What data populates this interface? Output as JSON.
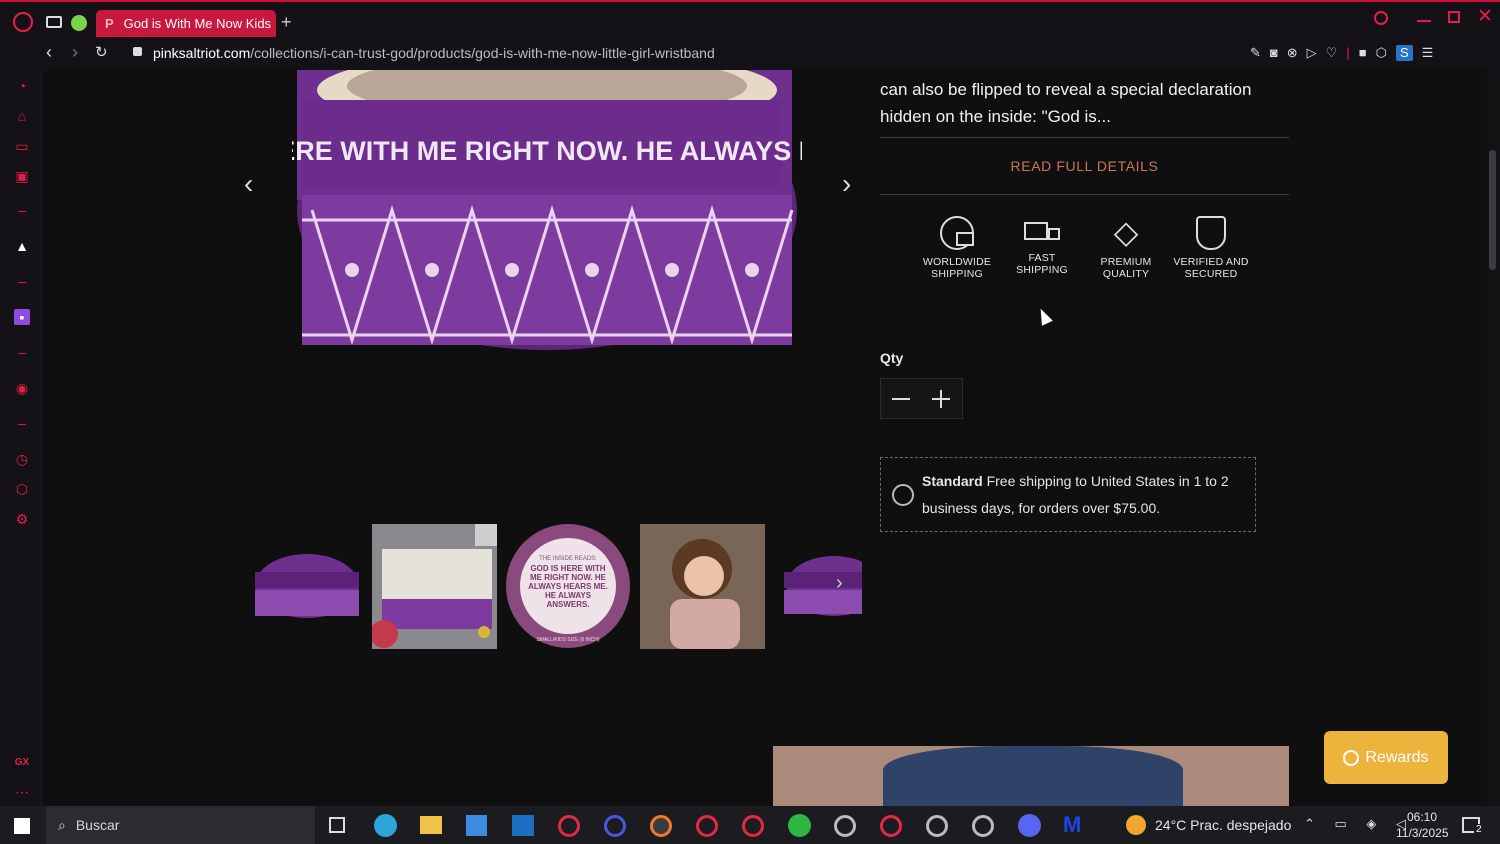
{
  "browser": {
    "tab_title": "God is With Me Now Kids",
    "tab_favicon_letter": "P",
    "url_domain": "pinksaltriot.com",
    "url_path": "/collections/i-can-trust-god/products/god-is-with-me-now-little-girl-wristband"
  },
  "product": {
    "description_line1": "can also be flipped to reveal a special declaration",
    "description_line2": "hidden on the inside: \"God is...",
    "read_more": "READ FULL DETAILS",
    "features": [
      {
        "line1": "WORLDWIDE",
        "line2": "SHIPPING",
        "icon": "globe-box-icon"
      },
      {
        "line1": "FAST",
        "line2": "SHIPPING",
        "icon": "truck-icon"
      },
      {
        "line1": "PREMIUM",
        "line2": "QUALITY",
        "icon": "diamond-icon"
      },
      {
        "line1": "VERIFIED AND",
        "line2": "SECURED",
        "icon": "shield-lock-icon"
      }
    ],
    "qty_label": "Qty",
    "shipping_title": "Standard",
    "shipping_text1": "Free shipping to United States in 1 to 2",
    "shipping_text2": "business days, for orders over $75.00.",
    "band_text": "HERE WITH ME RIGHT NOW. HE ALWAYS HE",
    "thumb_circle_label": "THE INSIDE READS:",
    "thumb_circle_text": "GOD IS HERE WITH ME RIGHT NOW. HE ALWAYS HEARS ME. HE ALWAYS ANSWERS.",
    "thumb_circle_size": "SMALL/KIDS SIZE (6 INCH)"
  },
  "rewards_label": "Rewards",
  "taskbar": {
    "search_placeholder": "Buscar",
    "weather": "24°C  Prac. despejado",
    "time": "06:10",
    "date": "11/3/2025",
    "notifications": "2"
  },
  "colors": {
    "accent": "#e61d46",
    "rewards": "#ecb43c",
    "read_more": "#c9745f",
    "band": "#6b2c8c"
  }
}
